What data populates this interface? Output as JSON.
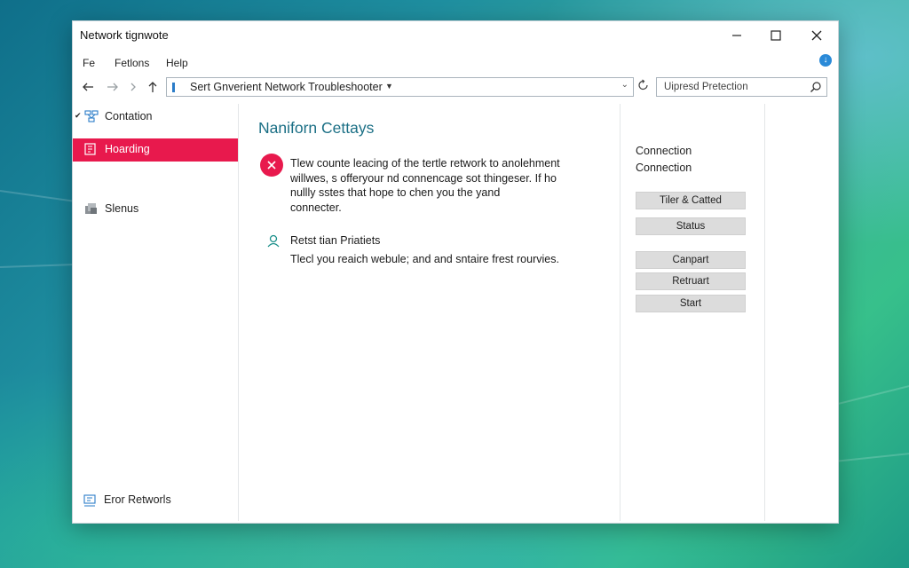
{
  "window": {
    "title": "Network tignwote",
    "controls": {
      "minimize": "minimize-icon",
      "maximize": "maximize-icon",
      "close": "close-icon"
    }
  },
  "menu": {
    "items": [
      "Fe",
      "Fetlons",
      "Help"
    ]
  },
  "navigation": {
    "address": "Sert Gnverient Network Troubleshooter",
    "search_placeholder": "Uipresd Pretection"
  },
  "sidebar": {
    "items": [
      {
        "label": "Contation",
        "icon": "network-icon",
        "active": false,
        "checked": true
      },
      {
        "label": "Hoarding",
        "icon": "document-icon",
        "active": true,
        "checked": false
      },
      {
        "label": "Slenus",
        "icon": "stack-icon",
        "active": false,
        "checked": false
      }
    ],
    "bottom_label": "Eror Retworls"
  },
  "main": {
    "title": "Naniforn Cettays",
    "error_lines": [
      "Tlew counte leacing of the tertle retwork to anolehment",
      "willwes, s offeryour nd connencage sot thingeser. If ho",
      "nullly sstes that hope to chen you the yand",
      "connecter."
    ],
    "tip_title": "Retst tian Priatiets",
    "tip_text": "Tlecl you reaich webule; and and sntaire frest rourvies."
  },
  "right_panel": {
    "heading_1": "Connection",
    "heading_2": "Connection",
    "buttons": [
      "Tiler & Catted",
      "Status",
      "Canpart",
      "Retruart",
      "Start"
    ]
  },
  "colors": {
    "accent": "#e8194d",
    "title_teal": "#1b6f85",
    "link_blue": "#2a7cc8"
  }
}
